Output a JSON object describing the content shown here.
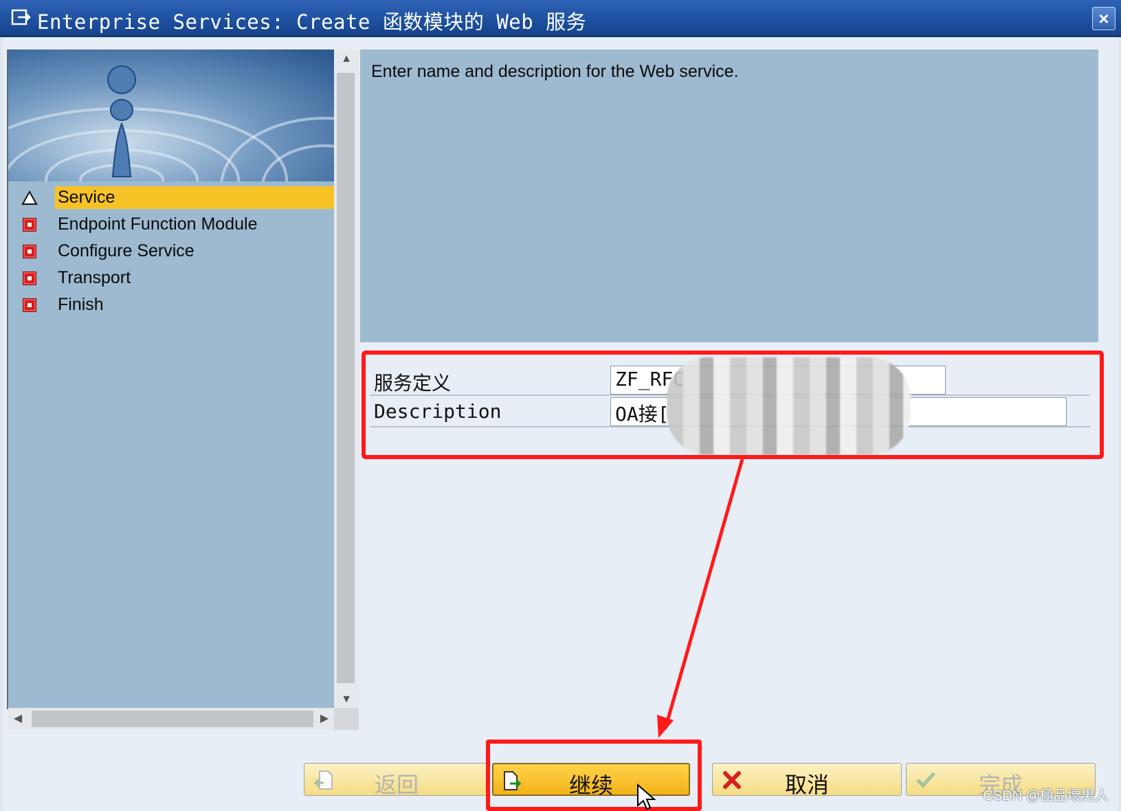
{
  "window": {
    "title": "Enterprise Services: Create 函数模块的 Web 服务",
    "close_label": "×"
  },
  "nav": {
    "steps": [
      {
        "label": "Service",
        "status": "current",
        "icon": "warning-triangle-icon"
      },
      {
        "label": "Endpoint Function Module",
        "status": "pending",
        "icon": "red-square-icon"
      },
      {
        "label": "Configure Service",
        "status": "pending",
        "icon": "red-square-icon"
      },
      {
        "label": "Transport",
        "status": "pending",
        "icon": "red-square-icon"
      },
      {
        "label": "Finish",
        "status": "pending",
        "icon": "red-square-icon"
      }
    ]
  },
  "info": {
    "text": "Enter name and description for the Web service."
  },
  "form": {
    "service_label": "服务定义",
    "service_value": "ZF_RFC",
    "description_label": "Description",
    "description_value": "OA接["
  },
  "buttons": {
    "back": "返回",
    "continue": "继续",
    "cancel": "取消",
    "finish": "完成"
  },
  "watermark": "CSDN @極品壞男人",
  "colors": {
    "title_bar": "#1d4f9e",
    "panel": "#9dbad0",
    "active_step": "#f7c225",
    "highlight": "#ff1a1a"
  }
}
